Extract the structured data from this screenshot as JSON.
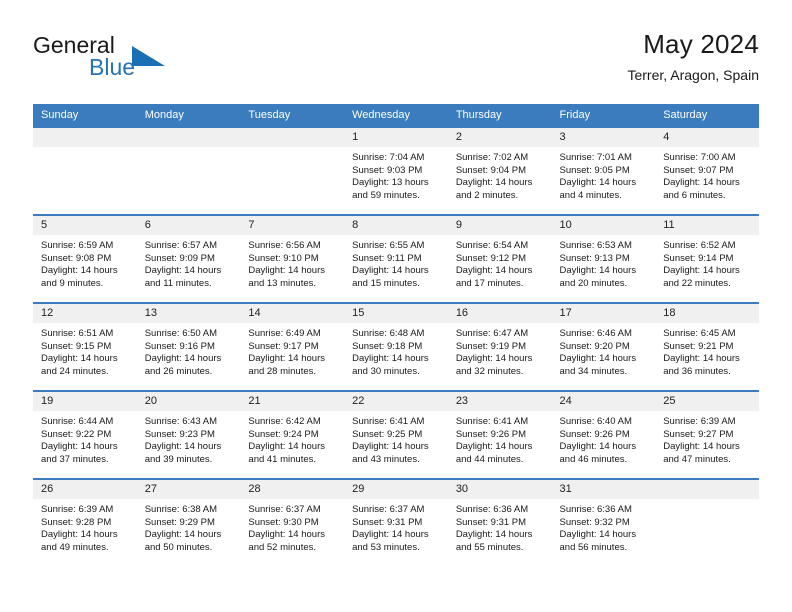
{
  "brand": {
    "name_part1": "General",
    "name_part2": "Blue",
    "triangle_color": "#1a6fb5",
    "blue_color": "#2572b6"
  },
  "header": {
    "title": "May 2024",
    "subtitle": "Terrer, Aragon, Spain"
  },
  "theme": {
    "header_row_bg": "#3a7cbe",
    "daynum_band_bg": "#f0f0f0",
    "cell_bg": "#ffffff",
    "text_color": "#1a1a1a"
  },
  "weekday_headers": [
    "Sunday",
    "Monday",
    "Tuesday",
    "Wednesday",
    "Thursday",
    "Friday",
    "Saturday"
  ],
  "labels": {
    "sunrise_prefix": "Sunrise:",
    "sunset_prefix": "Sunset:",
    "daylight_prefix": "Daylight:"
  },
  "weeks": [
    [
      {
        "day": "",
        "empty": true,
        "line1": "",
        "line2": "",
        "line3": "",
        "line4": ""
      },
      {
        "day": "",
        "empty": true,
        "line1": "",
        "line2": "",
        "line3": "",
        "line4": ""
      },
      {
        "day": "",
        "empty": true,
        "line1": "",
        "line2": "",
        "line3": "",
        "line4": ""
      },
      {
        "day": "1",
        "empty": false,
        "line1": "Sunrise: 7:04 AM",
        "line2": "Sunset: 9:03 PM",
        "line3": "Daylight: 13 hours",
        "line4": "and 59 minutes."
      },
      {
        "day": "2",
        "empty": false,
        "line1": "Sunrise: 7:02 AM",
        "line2": "Sunset: 9:04 PM",
        "line3": "Daylight: 14 hours",
        "line4": "and 2 minutes."
      },
      {
        "day": "3",
        "empty": false,
        "line1": "Sunrise: 7:01 AM",
        "line2": "Sunset: 9:05 PM",
        "line3": "Daylight: 14 hours",
        "line4": "and 4 minutes."
      },
      {
        "day": "4",
        "empty": false,
        "line1": "Sunrise: 7:00 AM",
        "line2": "Sunset: 9:07 PM",
        "line3": "Daylight: 14 hours",
        "line4": "and 6 minutes."
      }
    ],
    [
      {
        "day": "5",
        "empty": false,
        "line1": "Sunrise: 6:59 AM",
        "line2": "Sunset: 9:08 PM",
        "line3": "Daylight: 14 hours",
        "line4": "and 9 minutes."
      },
      {
        "day": "6",
        "empty": false,
        "line1": "Sunrise: 6:57 AM",
        "line2": "Sunset: 9:09 PM",
        "line3": "Daylight: 14 hours",
        "line4": "and 11 minutes."
      },
      {
        "day": "7",
        "empty": false,
        "line1": "Sunrise: 6:56 AM",
        "line2": "Sunset: 9:10 PM",
        "line3": "Daylight: 14 hours",
        "line4": "and 13 minutes."
      },
      {
        "day": "8",
        "empty": false,
        "line1": "Sunrise: 6:55 AM",
        "line2": "Sunset: 9:11 PM",
        "line3": "Daylight: 14 hours",
        "line4": "and 15 minutes."
      },
      {
        "day": "9",
        "empty": false,
        "line1": "Sunrise: 6:54 AM",
        "line2": "Sunset: 9:12 PM",
        "line3": "Daylight: 14 hours",
        "line4": "and 17 minutes."
      },
      {
        "day": "10",
        "empty": false,
        "line1": "Sunrise: 6:53 AM",
        "line2": "Sunset: 9:13 PM",
        "line3": "Daylight: 14 hours",
        "line4": "and 20 minutes."
      },
      {
        "day": "11",
        "empty": false,
        "line1": "Sunrise: 6:52 AM",
        "line2": "Sunset: 9:14 PM",
        "line3": "Daylight: 14 hours",
        "line4": "and 22 minutes."
      }
    ],
    [
      {
        "day": "12",
        "empty": false,
        "line1": "Sunrise: 6:51 AM",
        "line2": "Sunset: 9:15 PM",
        "line3": "Daylight: 14 hours",
        "line4": "and 24 minutes."
      },
      {
        "day": "13",
        "empty": false,
        "line1": "Sunrise: 6:50 AM",
        "line2": "Sunset: 9:16 PM",
        "line3": "Daylight: 14 hours",
        "line4": "and 26 minutes."
      },
      {
        "day": "14",
        "empty": false,
        "line1": "Sunrise: 6:49 AM",
        "line2": "Sunset: 9:17 PM",
        "line3": "Daylight: 14 hours",
        "line4": "and 28 minutes."
      },
      {
        "day": "15",
        "empty": false,
        "line1": "Sunrise: 6:48 AM",
        "line2": "Sunset: 9:18 PM",
        "line3": "Daylight: 14 hours",
        "line4": "and 30 minutes."
      },
      {
        "day": "16",
        "empty": false,
        "line1": "Sunrise: 6:47 AM",
        "line2": "Sunset: 9:19 PM",
        "line3": "Daylight: 14 hours",
        "line4": "and 32 minutes."
      },
      {
        "day": "17",
        "empty": false,
        "line1": "Sunrise: 6:46 AM",
        "line2": "Sunset: 9:20 PM",
        "line3": "Daylight: 14 hours",
        "line4": "and 34 minutes."
      },
      {
        "day": "18",
        "empty": false,
        "line1": "Sunrise: 6:45 AM",
        "line2": "Sunset: 9:21 PM",
        "line3": "Daylight: 14 hours",
        "line4": "and 36 minutes."
      }
    ],
    [
      {
        "day": "19",
        "empty": false,
        "line1": "Sunrise: 6:44 AM",
        "line2": "Sunset: 9:22 PM",
        "line3": "Daylight: 14 hours",
        "line4": "and 37 minutes."
      },
      {
        "day": "20",
        "empty": false,
        "line1": "Sunrise: 6:43 AM",
        "line2": "Sunset: 9:23 PM",
        "line3": "Daylight: 14 hours",
        "line4": "and 39 minutes."
      },
      {
        "day": "21",
        "empty": false,
        "line1": "Sunrise: 6:42 AM",
        "line2": "Sunset: 9:24 PM",
        "line3": "Daylight: 14 hours",
        "line4": "and 41 minutes."
      },
      {
        "day": "22",
        "empty": false,
        "line1": "Sunrise: 6:41 AM",
        "line2": "Sunset: 9:25 PM",
        "line3": "Daylight: 14 hours",
        "line4": "and 43 minutes."
      },
      {
        "day": "23",
        "empty": false,
        "line1": "Sunrise: 6:41 AM",
        "line2": "Sunset: 9:26 PM",
        "line3": "Daylight: 14 hours",
        "line4": "and 44 minutes."
      },
      {
        "day": "24",
        "empty": false,
        "line1": "Sunrise: 6:40 AM",
        "line2": "Sunset: 9:26 PM",
        "line3": "Daylight: 14 hours",
        "line4": "and 46 minutes."
      },
      {
        "day": "25",
        "empty": false,
        "line1": "Sunrise: 6:39 AM",
        "line2": "Sunset: 9:27 PM",
        "line3": "Daylight: 14 hours",
        "line4": "and 47 minutes."
      }
    ],
    [
      {
        "day": "26",
        "empty": false,
        "line1": "Sunrise: 6:39 AM",
        "line2": "Sunset: 9:28 PM",
        "line3": "Daylight: 14 hours",
        "line4": "and 49 minutes."
      },
      {
        "day": "27",
        "empty": false,
        "line1": "Sunrise: 6:38 AM",
        "line2": "Sunset: 9:29 PM",
        "line3": "Daylight: 14 hours",
        "line4": "and 50 minutes."
      },
      {
        "day": "28",
        "empty": false,
        "line1": "Sunrise: 6:37 AM",
        "line2": "Sunset: 9:30 PM",
        "line3": "Daylight: 14 hours",
        "line4": "and 52 minutes."
      },
      {
        "day": "29",
        "empty": false,
        "line1": "Sunrise: 6:37 AM",
        "line2": "Sunset: 9:31 PM",
        "line3": "Daylight: 14 hours",
        "line4": "and 53 minutes."
      },
      {
        "day": "30",
        "empty": false,
        "line1": "Sunrise: 6:36 AM",
        "line2": "Sunset: 9:31 PM",
        "line3": "Daylight: 14 hours",
        "line4": "and 55 minutes."
      },
      {
        "day": "31",
        "empty": false,
        "line1": "Sunrise: 6:36 AM",
        "line2": "Sunset: 9:32 PM",
        "line3": "Daylight: 14 hours",
        "line4": "and 56 minutes."
      },
      {
        "day": "",
        "empty": true,
        "line1": "",
        "line2": "",
        "line3": "",
        "line4": ""
      }
    ]
  ]
}
